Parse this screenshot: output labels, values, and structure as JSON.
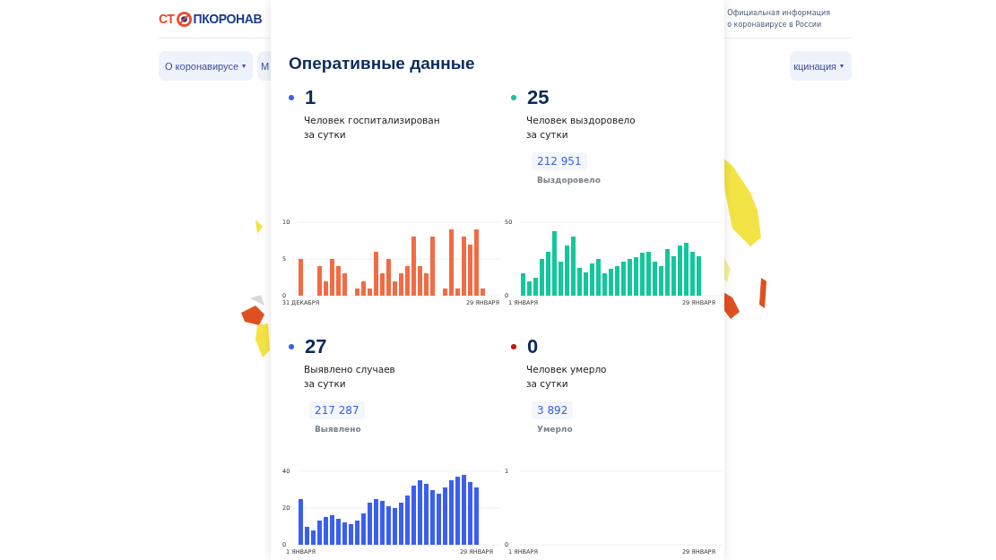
{
  "header": {
    "logo": {
      "part_1": "СТ",
      "part_2": "ПКОРОНАВ"
    },
    "tagline": [
      "Официальная информация",
      "о коронавирусе в России"
    ]
  },
  "nav": [
    {
      "label": "О коронавирусе",
      "caret": "▾"
    },
    {
      "label": "М"
    },
    {
      "label": "кцинация",
      "caret": "▾"
    }
  ],
  "panel": {
    "title": "Оперативные данные",
    "stats": [
      {
        "value": "1",
        "color": "#3a62e0",
        "label": [
          "Человек госпитализирован",
          "за сутки"
        ],
        "chart_data": {
          "type": "bar",
          "categories": [
            "31 ДЕКАБРЯ",
            null,
            null,
            null,
            null,
            null,
            null,
            null,
            null,
            null,
            null,
            null,
            null,
            null,
            null,
            null,
            null,
            null,
            null,
            null,
            null,
            null,
            null,
            null,
            null,
            null,
            null,
            null,
            null,
            "29 ЯНВАРЯ"
          ],
          "ylim": [
            0,
            10
          ],
          "yticks": [
            0,
            5,
            10
          ],
          "series": [
            {
              "color": "#f26b43",
              "values": [
                5,
                0,
                0,
                4,
                2,
                5,
                4,
                3,
                0,
                1,
                2,
                1,
                6,
                3,
                5,
                2,
                3,
                4,
                8,
                4,
                3,
                8,
                0,
                1,
                9,
                1,
                8,
                7,
                9,
                1
              ]
            }
          ]
        }
      },
      {
        "value": "25",
        "color": "#15c4a0",
        "label": [
          "Человек выздоровело",
          "за сутки"
        ],
        "total": "212 951",
        "total_label": "Выздоровело",
        "chart_data": {
          "type": "bar",
          "categories": [
            "1 ЯНВАРЯ",
            null,
            null,
            null,
            null,
            null,
            null,
            null,
            null,
            null,
            null,
            null,
            null,
            null,
            null,
            null,
            null,
            null,
            null,
            null,
            null,
            null,
            null,
            null,
            null,
            null,
            null,
            null,
            "29 ЯНВАРЯ"
          ],
          "ylim": [
            0,
            50
          ],
          "yticks": [
            0,
            50
          ],
          "series": [
            {
              "color": "#12c79c",
              "values": [
                15,
                10,
                12,
                25,
                30,
                44,
                23,
                34,
                40,
                19,
                16,
                22,
                25,
                15,
                18,
                20,
                23,
                25,
                26,
                29,
                30,
                23,
                20,
                32,
                27,
                34,
                36,
                30,
                27
              ]
            }
          ]
        }
      },
      {
        "value": "27",
        "color": "#3a62e0",
        "label": [
          "Выявлено случаев",
          "за сутки"
        ],
        "total": "217 287",
        "total_label": "Выявлено",
        "chart_data": {
          "type": "bar",
          "categories": [
            "1 ЯНВАРЯ",
            null,
            null,
            null,
            null,
            null,
            null,
            null,
            null,
            null,
            null,
            null,
            null,
            null,
            null,
            null,
            null,
            null,
            null,
            null,
            null,
            null,
            null,
            null,
            null,
            null,
            null,
            null,
            "29 ЯНВАРЯ"
          ],
          "ylim": [
            0,
            40
          ],
          "yticks": [
            0,
            20,
            40
          ],
          "series": [
            {
              "color": "#3a5ff0",
              "values": [
                25,
                10,
                8,
                13,
                15,
                16,
                14,
                12,
                11,
                13,
                17,
                23,
                25,
                24,
                21,
                20,
                23,
                27,
                32,
                35,
                33,
                30,
                28,
                31,
                35,
                37,
                38,
                34,
                31
              ]
            }
          ]
        }
      },
      {
        "value": "0",
        "color": "#c0151d",
        "label": [
          "Человек умерло",
          "за сутки"
        ],
        "total": "3 892",
        "total_label": "Умерло",
        "chart_data": {
          "type": "bar",
          "categories": [
            "1 ЯНВАРЯ",
            null,
            null,
            null,
            null,
            null,
            null,
            null,
            null,
            null,
            null,
            null,
            null,
            null,
            null,
            null,
            null,
            null,
            null,
            null,
            null,
            null,
            null,
            null,
            null,
            null,
            null,
            null,
            "29 ЯНВАРЯ"
          ],
          "ylim": [
            0,
            1
          ],
          "yticks": [
            0,
            1
          ],
          "series": [
            {
              "color": "#d9362b",
              "values": [
                0,
                0,
                0,
                0,
                0,
                0,
                0,
                0,
                0,
                0,
                0,
                0,
                0,
                0,
                0,
                0,
                0,
                0,
                0,
                0,
                0,
                0,
                0,
                0,
                0,
                0,
                0,
                0,
                0
              ]
            }
          ]
        }
      }
    ]
  }
}
